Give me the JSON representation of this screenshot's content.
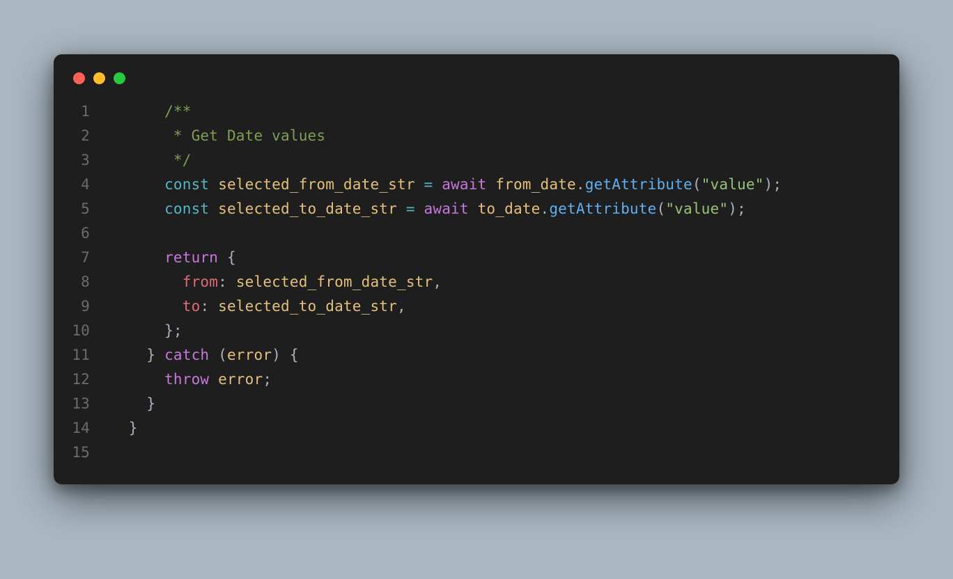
{
  "window": {
    "traffic_lights": [
      "close",
      "minimize",
      "zoom"
    ]
  },
  "editor": {
    "line_numbers": [
      "1",
      "2",
      "3",
      "4",
      "5",
      "6",
      "7",
      "8",
      "9",
      "10",
      "11",
      "12",
      "13",
      "14",
      "15"
    ],
    "indent_unit": "  ",
    "lines": [
      {
        "indent": 3,
        "tokens": [
          {
            "t": "/**",
            "c": "comment"
          }
        ]
      },
      {
        "indent": 3,
        "tokens": [
          {
            "t": " * Get Date values",
            "c": "comment"
          }
        ]
      },
      {
        "indent": 3,
        "tokens": [
          {
            "t": " */",
            "c": "comment"
          }
        ]
      },
      {
        "indent": 3,
        "tokens": [
          {
            "t": "const",
            "c": "keyword2"
          },
          {
            "t": " ",
            "c": "punc"
          },
          {
            "t": "selected_from_date_str",
            "c": "ident"
          },
          {
            "t": " ",
            "c": "punc"
          },
          {
            "t": "=",
            "c": "op"
          },
          {
            "t": " ",
            "c": "punc"
          },
          {
            "t": "await",
            "c": "keyword"
          },
          {
            "t": " ",
            "c": "punc"
          },
          {
            "t": "from_date",
            "c": "ident"
          },
          {
            "t": ".",
            "c": "punc"
          },
          {
            "t": "getAttribute",
            "c": "func"
          },
          {
            "t": "(",
            "c": "punc"
          },
          {
            "t": "\"value\"",
            "c": "string"
          },
          {
            "t": ");",
            "c": "punc"
          }
        ]
      },
      {
        "indent": 3,
        "tokens": [
          {
            "t": "const",
            "c": "keyword2"
          },
          {
            "t": " ",
            "c": "punc"
          },
          {
            "t": "selected_to_date_str",
            "c": "ident"
          },
          {
            "t": " ",
            "c": "punc"
          },
          {
            "t": "=",
            "c": "op"
          },
          {
            "t": " ",
            "c": "punc"
          },
          {
            "t": "await",
            "c": "keyword"
          },
          {
            "t": " ",
            "c": "punc"
          },
          {
            "t": "to_date",
            "c": "ident"
          },
          {
            "t": ".",
            "c": "punc"
          },
          {
            "t": "getAttribute",
            "c": "func"
          },
          {
            "t": "(",
            "c": "punc"
          },
          {
            "t": "\"value\"",
            "c": "string"
          },
          {
            "t": ");",
            "c": "punc"
          }
        ]
      },
      {
        "indent": 0,
        "tokens": []
      },
      {
        "indent": 3,
        "tokens": [
          {
            "t": "return",
            "c": "keyword"
          },
          {
            "t": " {",
            "c": "punc"
          }
        ]
      },
      {
        "indent": 4,
        "tokens": [
          {
            "t": "from",
            "c": "prop"
          },
          {
            "t": ": ",
            "c": "punc"
          },
          {
            "t": "selected_from_date_str",
            "c": "ident"
          },
          {
            "t": ",",
            "c": "punc"
          }
        ]
      },
      {
        "indent": 4,
        "tokens": [
          {
            "t": "to",
            "c": "prop"
          },
          {
            "t": ": ",
            "c": "punc"
          },
          {
            "t": "selected_to_date_str",
            "c": "ident"
          },
          {
            "t": ",",
            "c": "punc"
          }
        ]
      },
      {
        "indent": 3,
        "tokens": [
          {
            "t": "};",
            "c": "punc"
          }
        ]
      },
      {
        "indent": 2,
        "tokens": [
          {
            "t": "} ",
            "c": "punc"
          },
          {
            "t": "catch",
            "c": "keyword"
          },
          {
            "t": " (",
            "c": "punc"
          },
          {
            "t": "error",
            "c": "ident"
          },
          {
            "t": ") {",
            "c": "punc"
          }
        ]
      },
      {
        "indent": 3,
        "tokens": [
          {
            "t": "throw",
            "c": "keyword"
          },
          {
            "t": " ",
            "c": "punc"
          },
          {
            "t": "error",
            "c": "ident"
          },
          {
            "t": ";",
            "c": "punc"
          }
        ]
      },
      {
        "indent": 2,
        "tokens": [
          {
            "t": "}",
            "c": "punc"
          }
        ]
      },
      {
        "indent": 1,
        "tokens": [
          {
            "t": "}",
            "c": "punc"
          }
        ]
      },
      {
        "indent": 0,
        "tokens": []
      }
    ]
  }
}
